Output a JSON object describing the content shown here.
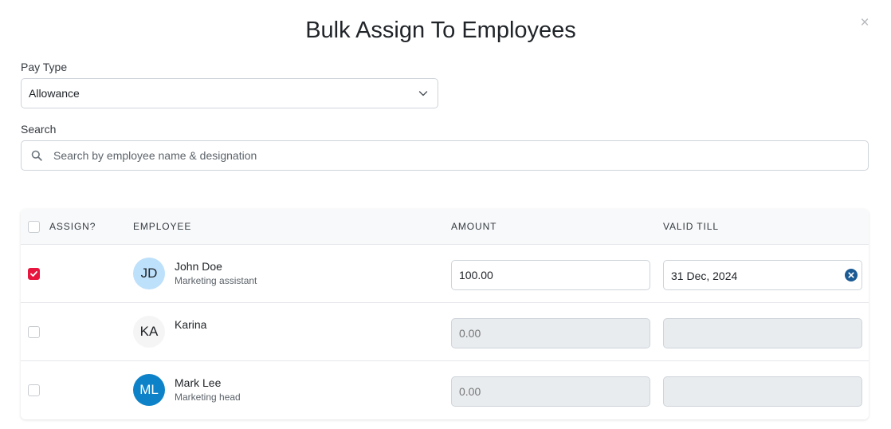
{
  "modal": {
    "title": "Bulk Assign To Employees",
    "close_label": "×"
  },
  "pay_type": {
    "label": "Pay Type",
    "value": "Allowance",
    "icon": "chevron-down-icon"
  },
  "search": {
    "label": "Search",
    "placeholder": "Search by employee name & designation",
    "value": "",
    "icon": "search-icon"
  },
  "table": {
    "headers": {
      "assign": "ASSIGN?",
      "employee": "EMPLOYEE",
      "amount": "AMOUNT",
      "valid_till": "VALID TILL"
    },
    "select_all_checked": false,
    "rows": [
      {
        "checked": true,
        "initials": "JD",
        "name": "John Doe",
        "designation": "Marketing assistant",
        "avatar_bg": "#bde0fb",
        "avatar_fg": "#212529",
        "amount": "100.00",
        "amount_disabled": false,
        "valid_till": "31 Dec, 2024"
      },
      {
        "checked": false,
        "initials": "KA",
        "name": "Karina",
        "designation": "",
        "avatar_bg": "#f5f5f5",
        "avatar_fg": "#212529",
        "amount": "0.00",
        "amount_disabled": true,
        "valid_till": ""
      },
      {
        "checked": false,
        "initials": "ML",
        "name": "Mark Lee",
        "designation": "Marketing head",
        "avatar_bg": "#0d82c9",
        "avatar_fg": "#ffffff",
        "amount": "0.00",
        "amount_disabled": true,
        "valid_till": ""
      }
    ]
  },
  "colors": {
    "checkbox_checked": "#e8163f",
    "clear_icon": "#1b5b94"
  }
}
